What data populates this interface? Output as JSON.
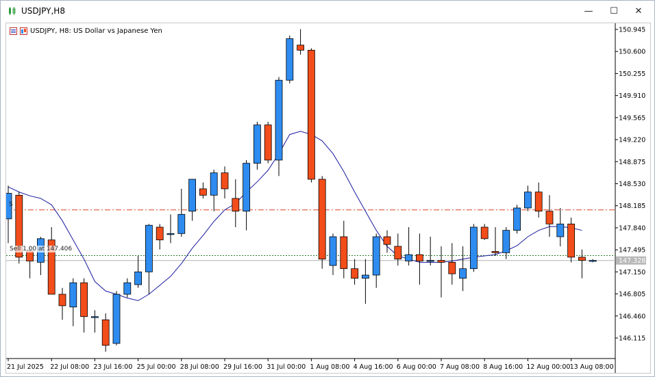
{
  "window": {
    "title": "USDJPY,H8",
    "minimize_label": "—",
    "maximize_label": "☐",
    "close_label": "✕"
  },
  "chart_header": {
    "symbol_text": "USDJPY, H8:  US Dollar vs Japanese Yen"
  },
  "trade_lines": {
    "sell_label": "Sell 1.00  at 147.406",
    "s_marker": "S"
  },
  "colors": {
    "bull": "#2e8cf0",
    "bear": "#f24d1a",
    "ma": "#1a1aa0",
    "tp_line": "#e04020",
    "entry_line": "#2a7a2a",
    "bid_line": "#b0b0b0",
    "bid_label_bg": "#b8b8b8"
  },
  "chart_data": {
    "type": "candlestick",
    "title": "USDJPY, H8:  US Dollar vs Japanese Yen",
    "ylim": [
      145.85,
      151.05
    ],
    "y_ticks": [
      "150.945",
      "150.600",
      "150.255",
      "149.910",
      "149.565",
      "149.220",
      "148.875",
      "148.530",
      "148.185",
      "147.840",
      "147.495",
      "147.150",
      "146.805",
      "146.460",
      "146.115"
    ],
    "x_ticks": [
      {
        "index": 0,
        "label": "21 Jul 2025"
      },
      {
        "index": 4,
        "label": "22 Jul 08:00"
      },
      {
        "index": 8,
        "label": "23 Jul 16:00"
      },
      {
        "index": 12,
        "label": "25 Jul 00:00"
      },
      {
        "index": 16,
        "label": "28 Jul 08:00"
      },
      {
        "index": 20,
        "label": "29 Jul 16:00"
      },
      {
        "index": 24,
        "label": "31 Jul 00:00"
      },
      {
        "index": 28,
        "label": "1 Aug 08:00"
      },
      {
        "index": 32,
        "label": "4 Aug 16:00"
      },
      {
        "index": 36,
        "label": "6 Aug 00:00"
      },
      {
        "index": 40,
        "label": "7 Aug 08:00"
      },
      {
        "index": 44,
        "label": "8 Aug 16:00"
      },
      {
        "index": 48,
        "label": "12 Aug 00:00"
      },
      {
        "index": 52,
        "label": "13 Aug 08:00"
      }
    ],
    "current_price": "147.328",
    "horizontal_lines": [
      {
        "name": "take-profit",
        "value": 148.12,
        "style": "dash-dot"
      },
      {
        "name": "sell-entry",
        "value": 147.406,
        "style": "dotted"
      },
      {
        "name": "bid",
        "value": 147.328,
        "style": "solid"
      }
    ],
    "candles": [
      {
        "o": 147.98,
        "h": 148.5,
        "l": 147.6,
        "c": 148.38
      },
      {
        "o": 148.35,
        "h": 148.4,
        "l": 147.28,
        "c": 147.38
      },
      {
        "o": 147.48,
        "h": 147.55,
        "l": 147.05,
        "c": 147.32
      },
      {
        "o": 147.3,
        "h": 147.7,
        "l": 147.1,
        "c": 147.67
      },
      {
        "o": 147.65,
        "h": 147.85,
        "l": 146.95,
        "c": 146.8
      },
      {
        "o": 146.8,
        "h": 146.9,
        "l": 146.4,
        "c": 146.62
      },
      {
        "o": 146.6,
        "h": 147.05,
        "l": 146.3,
        "c": 146.98
      },
      {
        "o": 146.98,
        "h": 147.05,
        "l": 146.2,
        "c": 146.45
      },
      {
        "o": 146.45,
        "h": 146.55,
        "l": 146.2,
        "c": 146.45
      },
      {
        "o": 146.4,
        "h": 146.5,
        "l": 145.9,
        "c": 146.0
      },
      {
        "o": 146.03,
        "h": 146.85,
        "l": 146.0,
        "c": 146.8
      },
      {
        "o": 146.8,
        "h": 147.05,
        "l": 146.75,
        "c": 146.98
      },
      {
        "o": 146.95,
        "h": 147.4,
        "l": 146.9,
        "c": 147.15
      },
      {
        "o": 147.15,
        "h": 147.9,
        "l": 146.8,
        "c": 147.88
      },
      {
        "o": 147.85,
        "h": 147.9,
        "l": 147.5,
        "c": 147.65
      },
      {
        "o": 147.75,
        "h": 148.05,
        "l": 147.6,
        "c": 147.75
      },
      {
        "o": 147.75,
        "h": 148.45,
        "l": 147.7,
        "c": 148.05
      },
      {
        "o": 148.1,
        "h": 148.6,
        "l": 147.95,
        "c": 148.6
      },
      {
        "o": 148.45,
        "h": 148.55,
        "l": 148.3,
        "c": 148.35
      },
      {
        "o": 148.35,
        "h": 148.75,
        "l": 148.1,
        "c": 148.7
      },
      {
        "o": 148.7,
        "h": 148.8,
        "l": 148.3,
        "c": 148.45
      },
      {
        "o": 148.3,
        "h": 148.6,
        "l": 147.85,
        "c": 148.1
      },
      {
        "o": 148.1,
        "h": 148.9,
        "l": 147.8,
        "c": 148.85
      },
      {
        "o": 148.85,
        "h": 149.5,
        "l": 148.75,
        "c": 149.45
      },
      {
        "o": 149.45,
        "h": 149.5,
        "l": 148.85,
        "c": 148.9
      },
      {
        "o": 148.9,
        "h": 150.2,
        "l": 148.65,
        "c": 150.15
      },
      {
        "o": 150.15,
        "h": 150.85,
        "l": 150.1,
        "c": 150.8
      },
      {
        "o": 150.7,
        "h": 150.95,
        "l": 150.55,
        "c": 150.62
      },
      {
        "o": 150.62,
        "h": 150.65,
        "l": 148.55,
        "c": 148.6
      },
      {
        "o": 148.6,
        "h": 148.65,
        "l": 147.2,
        "c": 147.35
      },
      {
        "o": 147.25,
        "h": 147.75,
        "l": 147.1,
        "c": 147.7
      },
      {
        "o": 147.7,
        "h": 147.95,
        "l": 147.05,
        "c": 147.2
      },
      {
        "o": 147.2,
        "h": 147.35,
        "l": 146.95,
        "c": 147.05
      },
      {
        "o": 147.05,
        "h": 147.35,
        "l": 146.65,
        "c": 147.1
      },
      {
        "o": 147.1,
        "h": 147.75,
        "l": 146.9,
        "c": 147.7
      },
      {
        "o": 147.7,
        "h": 147.8,
        "l": 147.45,
        "c": 147.58
      },
      {
        "o": 147.55,
        "h": 147.75,
        "l": 147.25,
        "c": 147.35
      },
      {
        "o": 147.32,
        "h": 147.85,
        "l": 147.25,
        "c": 147.42
      },
      {
        "o": 147.42,
        "h": 147.75,
        "l": 146.95,
        "c": 147.32
      },
      {
        "o": 147.32,
        "h": 147.7,
        "l": 147.25,
        "c": 147.33
      },
      {
        "o": 147.33,
        "h": 147.55,
        "l": 146.75,
        "c": 147.3
      },
      {
        "o": 147.3,
        "h": 147.6,
        "l": 146.95,
        "c": 147.12
      },
      {
        "o": 147.05,
        "h": 147.55,
        "l": 146.85,
        "c": 147.2
      },
      {
        "o": 147.2,
        "h": 147.9,
        "l": 147.15,
        "c": 147.85
      },
      {
        "o": 147.85,
        "h": 147.9,
        "l": 147.65,
        "c": 147.67
      },
      {
        "o": 147.47,
        "h": 147.85,
        "l": 147.4,
        "c": 147.45
      },
      {
        "o": 147.45,
        "h": 147.85,
        "l": 147.35,
        "c": 147.8
      },
      {
        "o": 147.8,
        "h": 148.2,
        "l": 147.75,
        "c": 148.15
      },
      {
        "o": 148.15,
        "h": 148.5,
        "l": 148.1,
        "c": 148.4
      },
      {
        "o": 148.4,
        "h": 148.55,
        "l": 148.0,
        "c": 148.1
      },
      {
        "o": 148.1,
        "h": 148.35,
        "l": 147.7,
        "c": 147.9
      },
      {
        "o": 147.7,
        "h": 148.15,
        "l": 147.55,
        "c": 147.9
      },
      {
        "o": 147.9,
        "h": 148.0,
        "l": 147.3,
        "c": 147.38
      },
      {
        "o": 147.38,
        "h": 147.5,
        "l": 147.05,
        "c": 147.33
      },
      {
        "o": 147.33,
        "h": 147.35,
        "l": 147.3,
        "c": 147.33
      }
    ],
    "moving_average": [
      148.48,
      148.4,
      148.34,
      148.3,
      148.2,
      147.95,
      147.65,
      147.35,
      147.0,
      146.85,
      146.8,
      146.74,
      146.7,
      146.8,
      146.94,
      147.08,
      147.28,
      147.52,
      147.72,
      147.94,
      148.12,
      148.22,
      148.4,
      148.56,
      148.74,
      149.0,
      149.3,
      149.35,
      149.3,
      149.2,
      149.0,
      148.72,
      148.4,
      148.1,
      147.8,
      147.55,
      147.4,
      147.35,
      147.3,
      147.3,
      147.3,
      147.32,
      147.35,
      147.38,
      147.4,
      147.42,
      147.48,
      147.56,
      147.7,
      147.8,
      147.86,
      147.86,
      147.84,
      147.8
    ]
  }
}
